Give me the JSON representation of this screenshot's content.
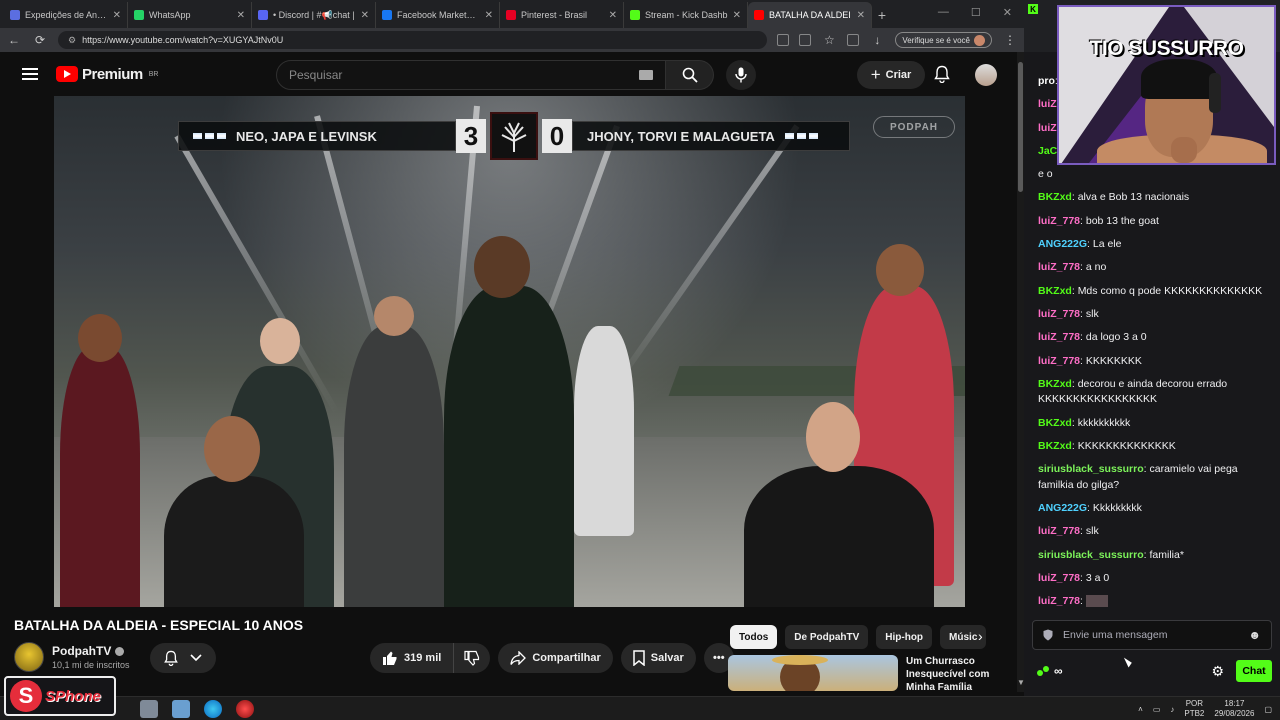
{
  "browser": {
    "tabs": [
      {
        "title": "Expedições de Anime | X",
        "color": "#5b6ee1",
        "active": false
      },
      {
        "title": "WhatsApp",
        "color": "#25d366",
        "active": false
      },
      {
        "title": "• Discord | #📢chat |",
        "color": "#5865f2",
        "active": false
      },
      {
        "title": "Facebook Marketplace |",
        "color": "#1877f2",
        "active": false
      },
      {
        "title": "Pinterest - Brasil",
        "color": "#e60023",
        "active": false
      },
      {
        "title": "Stream - Kick Dashb",
        "color": "#53fc18",
        "active": false
      },
      {
        "title": "BATALHA DA ALDEI",
        "color": "#ff0000",
        "active": true
      }
    ],
    "new_tab": "+",
    "window_controls": [
      "—",
      "☐",
      "✕"
    ],
    "url": "https://www.youtube.com/watch?v=XUGYAJtNv0U",
    "verify_label": "Verifique se é você"
  },
  "youtube": {
    "logo_text": "Premium",
    "logo_region": "BR",
    "search_placeholder": "Pesquisar",
    "create_label": "Criar",
    "scoreboard": {
      "left_team": "NEO, JAPA E LEVINSK",
      "left_score": "3",
      "right_score": "0",
      "right_team": "JHONY, TORVI E MALAGUETA",
      "watermark": "PODPAH"
    },
    "video_title": "BATALHA DA ALDEIA - ESPECIAL 10 ANOS",
    "channel_name": "PodpahTV",
    "channel_subs": "10,1 mi de inscritos",
    "likes": "319 mil",
    "share_label": "Compartilhar",
    "save_label": "Salvar",
    "chips": [
      {
        "label": "Todos",
        "selected": true
      },
      {
        "label": "De PodpahTV",
        "selected": false
      },
      {
        "label": "Hip-hop",
        "selected": false
      },
      {
        "label": "Músic",
        "selected": false
      }
    ],
    "recommended": {
      "title": "Um Churrasco Inesquecível com Minha Família"
    }
  },
  "stream": {
    "cam_title": "TIO SUSSURRO",
    "badge_text": "SPhone",
    "badge_letter": "S"
  },
  "chat": {
    "colors": {
      "green": "#53fc18",
      "pink": "#ff6ec7",
      "cyan": "#4fd1ff",
      "lime": "#7cf25a"
    },
    "messages": [
      {
        "user": "pro",
        "text": "",
        "color": "#ffffff"
      },
      {
        "user": "luiZ",
        "text": "",
        "color": "#ff6ec7"
      },
      {
        "user": "luiZ",
        "text": "",
        "color": "#ff6ec7"
      },
      {
        "user": "JaC",
        "text": "",
        "color": "#53fc18"
      },
      {
        "user": "",
        "text": "e o",
        "color": "#ffffff"
      },
      {
        "user": "BKZxd",
        "text": "alva e Bob 13 nacionais",
        "color": "#53fc18"
      },
      {
        "user": "luiZ_778",
        "text": "bob 13 the goat",
        "color": "#ff6ec7"
      },
      {
        "user": "ANG222G",
        "text": "La ele",
        "color": "#4fd1ff"
      },
      {
        "user": "luiZ_778",
        "text": "a no",
        "color": "#ff6ec7"
      },
      {
        "user": "BKZxd",
        "text": "Mds como q pode KKKKKKKKKKKKKK",
        "color": "#53fc18"
      },
      {
        "user": "luiZ_778",
        "text": "slk",
        "color": "#ff6ec7"
      },
      {
        "user": "luiZ_778",
        "text": "da logo 3 a 0",
        "color": "#ff6ec7"
      },
      {
        "user": "luiZ_778",
        "text": "KKKKKKKK",
        "color": "#ff6ec7"
      },
      {
        "user": "BKZxd",
        "text": "decorou e ainda decorou errado KKKKKKKKKKKKKKKKK",
        "color": "#53fc18"
      },
      {
        "user": "BKZxd",
        "text": "kkkkkkkkkk",
        "color": "#53fc18"
      },
      {
        "user": "BKZxd",
        "text": "KKKKKKKKKKKKKK",
        "color": "#53fc18"
      },
      {
        "user": "siriusblack_sussurro",
        "text": "caramielo vai pega familkia do gilga?",
        "color": "#7cf25a"
      },
      {
        "user": "ANG222G",
        "text": "Kkkkkkkkk",
        "color": "#4fd1ff"
      },
      {
        "user": "luiZ_778",
        "text": "slk",
        "color": "#ff6ec7"
      },
      {
        "user": "siriusblack_sussurro",
        "text": "familia*",
        "color": "#7cf25a"
      },
      {
        "user": "luiZ_778",
        "text": "3 a 0",
        "color": "#ff6ec7"
      },
      {
        "user": "luiZ_778",
        "text": "",
        "color": "#ff6ec7",
        "emote": true
      }
    ],
    "input_placeholder": "Envie uma mensagem",
    "points": "∞",
    "send_label": "Chat"
  },
  "taskbar": {
    "lang_top": "POR",
    "lang_bottom": "PTB2",
    "time": "18:17",
    "date": "29/08/2026"
  }
}
